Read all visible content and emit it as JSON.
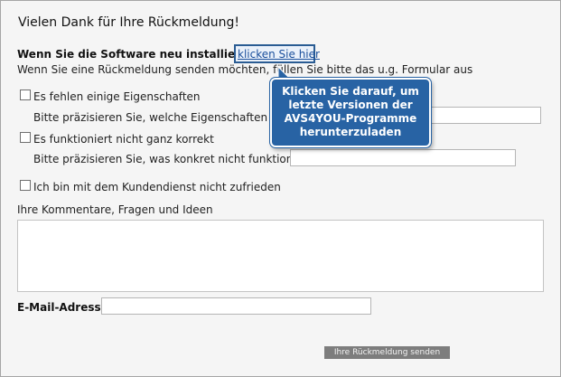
{
  "title": "Vielen Dank für Ihre Rückmeldung!",
  "reinstall": {
    "text": "Wenn Sie die Software neu installieren,",
    "link": "klicken Sie hier"
  },
  "feedback_intro": "Wenn Sie eine Rückmeldung senden möchten, füllen Sie bitte das u.g. Formular aus",
  "options": [
    {
      "label": "Es fehlen einige Eigenschaften",
      "checked": false,
      "detail_label": "Bitte präzisieren Sie, welche Eigenschaften Sie l",
      "detail_value": ""
    },
    {
      "label": "Es funktioniert nicht ganz korrekt",
      "checked": false,
      "detail_label": "Bitte präzisieren Sie, was konkret nicht funktioniert",
      "detail_value": ""
    },
    {
      "label": "Ich bin mit dem Kundendienst nicht zufrieden",
      "checked": false
    }
  ],
  "comments": {
    "label": "Ihre Kommentare, Fragen und Ideen",
    "value": ""
  },
  "email": {
    "label": "E-Mail-Adresse",
    "value": ""
  },
  "submit_label": "Ihre Rückmeldung senden",
  "callout": {
    "line1": "Klicken Sie darauf, um",
    "line2": "letzte Versionen der",
    "line3": "AVS4YOU-Programme",
    "line4": "herunterzuladen"
  },
  "colors": {
    "callout": "#2863a4",
    "link": "#1a4f9c",
    "button": "#7d7d7d"
  }
}
